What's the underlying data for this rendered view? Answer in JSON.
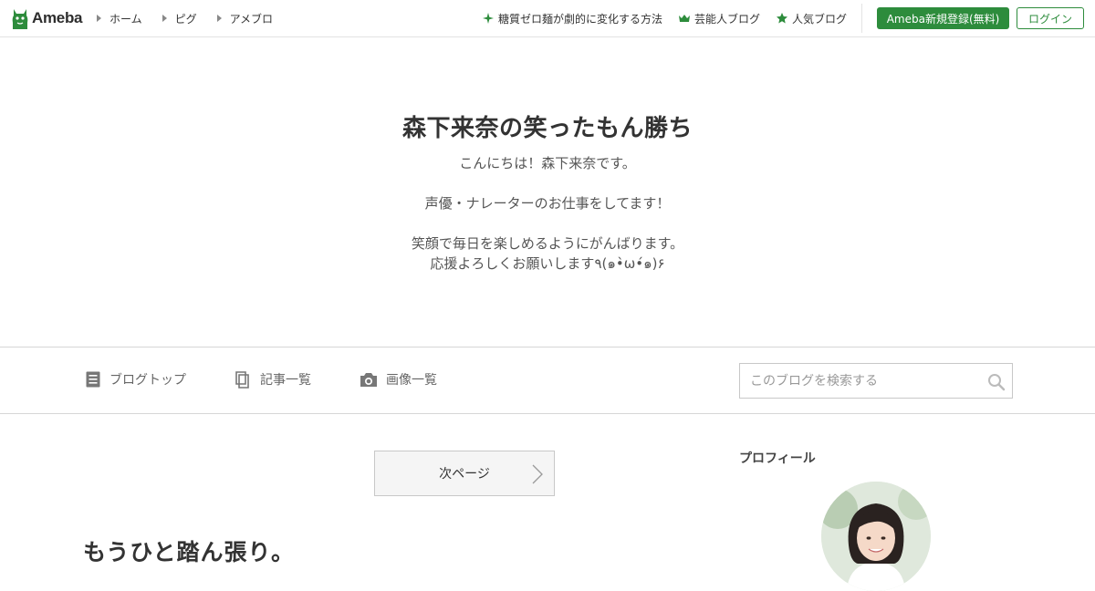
{
  "header": {
    "logo_text": "Ameba",
    "nav": [
      {
        "label": "ホーム"
      },
      {
        "label": "ピグ"
      },
      {
        "label": "アメブロ"
      }
    ],
    "links": [
      {
        "label": "糖質ゼロ麺が劇的に変化する方法",
        "icon": "sparkle-icon"
      },
      {
        "label": "芸能人ブログ",
        "icon": "crown-icon"
      },
      {
        "label": "人気ブログ",
        "icon": "star-icon"
      }
    ],
    "register_label": "Ameba新規登録(無料)",
    "login_label": "ログイン"
  },
  "blog": {
    "title": "森下来奈の笑ったもん勝ち",
    "description": [
      "こんにちは！森下来奈です。",
      "",
      "声優・ナレーターのお仕事をしてます！",
      "",
      "笑顔で毎日を楽しめるようにがんばります。",
      "応援よろしくお願いします٩(๑•̀ω•́๑)۶"
    ]
  },
  "blognav": {
    "items": [
      {
        "label": "ブログトップ",
        "icon": "document-icon"
      },
      {
        "label": "記事一覧",
        "icon": "copy-icon"
      },
      {
        "label": "画像一覧",
        "icon": "camera-icon"
      }
    ],
    "search_placeholder": "このブログを検索する"
  },
  "main": {
    "next_page_label": "次ページ",
    "entry_title": "もうひと踏ん張り。"
  },
  "sidebar": {
    "profile_heading": "プロフィール"
  },
  "colors": {
    "brand_green": "#2d8c3c",
    "border": "#d6d6d6"
  }
}
